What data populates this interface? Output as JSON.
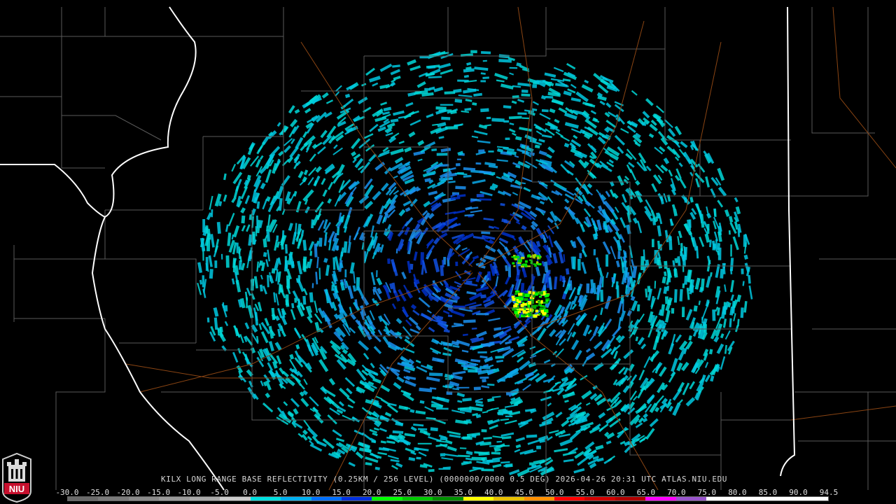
{
  "caption": {
    "site": "KILX",
    "product": "LONG RANGE BASE REFLECTIVITY",
    "resolution": "(0.25KM / 256 LEVEL)",
    "volume": "(0000000/0000",
    "tilt": "0.5 DEG)",
    "datetime": "2026-04-26 20:31 UTC",
    "source": "ATLAS.NIU.EDU"
  },
  "logo_text": "NIU",
  "scale_labels": [
    "-30.0",
    "-25.0",
    "-20.0",
    "-15.0",
    "-10.0",
    "-5.0",
    "0.0",
    "5.0",
    "10.0",
    "15.0",
    "20.0",
    "25.0",
    "30.0",
    "35.0",
    "40.0",
    "45.0",
    "50.0",
    "55.0",
    "60.0",
    "65.0",
    "70.0",
    "75.0",
    "80.0",
    "85.0",
    "90.0",
    "94.5"
  ],
  "scale_colors": [
    "#6a6a6a",
    "#7a7a7a",
    "#8a8a8a",
    "#9a9a9a",
    "#aaaaaa",
    "#cccccc",
    "#00e0e0",
    "#00b0f0",
    "#0070ff",
    "#0030e0",
    "#00ff00",
    "#00c800",
    "#009000",
    "#ffff00",
    "#e8c000",
    "#ff9000",
    "#ff0000",
    "#d00000",
    "#b00000",
    "#ff00ff",
    "#9955cc",
    "#ffffff",
    "#ffffff",
    "#ffffff",
    "#ffffff"
  ],
  "colors": {
    "state_border": "#ffffff",
    "county_line": "#5a5a5a",
    "highway": "#8b4513",
    "radar_site": "#000000"
  }
}
